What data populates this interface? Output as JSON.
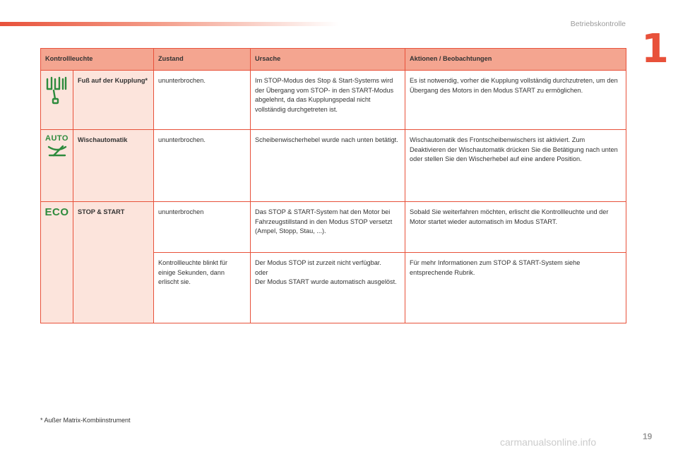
{
  "header": {
    "section_title": "Betriebskontrolle",
    "chapter_number": "1"
  },
  "table": {
    "headers": [
      "Kontrollleuchte",
      "Zustand",
      "Ursache",
      "Aktionen / Beobachtungen"
    ],
    "rows": [
      {
        "icon": "clutch-pedal-icon",
        "name": "Fuß auf der Kupplung*",
        "zustand": "ununterbrochen.",
        "ursache": "Im STOP-Modus des Stop & Start-Systems wird der Übergang vom STOP- in den START-Modus abgelehnt, da das Kupplungspedal nicht vollständig durchgetreten ist.",
        "aktion": "Es ist notwendig, vorher die Kupplung vollständig durchzutreten, um den Übergang des Motors in den Modus START zu ermöglichen."
      },
      {
        "icon": "auto-wiper-icon",
        "icon_text": "AUTO",
        "name": "Wischautomatik",
        "zustand": "ununterbrochen.",
        "ursache": "Scheibenwischerhebel wurde nach unten betätigt.",
        "aktion": "Wischautomatik des Frontscheibenwischers ist aktiviert. Zum Deaktivieren der Wischautomatik drücken Sie die Betätigung nach unten oder stellen Sie den Wischerhebel auf eine andere Position."
      },
      {
        "icon": "eco-icon",
        "icon_text": "ECO",
        "name": "STOP & START",
        "zustand": "ununterbrochen",
        "ursache": "Das STOP & START-System hat den Motor bei Fahrzeugstillstand in den Modus STOP versetzt (Ampel, Stopp, Stau, ...).",
        "aktion": "Sobald Sie weiterfahren möchten, erlischt die Kontrollleuchte und der Motor startet wieder automatisch im Modus START."
      },
      {
        "zustand": "Kontrollleuchte blinkt für einige Sekunden, dann erlischt sie.",
        "ursache_lines": [
          "Der Modus STOP ist zurzeit nicht verfügbar.",
          "oder",
          "Der Modus START wurde automatisch ausgelöst."
        ],
        "aktion": "Für mehr Informationen zum STOP & START-System siehe entsprechende Rubrik."
      }
    ]
  },
  "footnote": "* Außer Matrix-Kombiinstrument",
  "page_number": "19",
  "watermark": "carmanualsonline.info",
  "colors": {
    "accent": "#e8513a",
    "header_fill": "#f4a590",
    "label_fill": "#fce4dc",
    "icon_green": "#2e8b3d"
  }
}
